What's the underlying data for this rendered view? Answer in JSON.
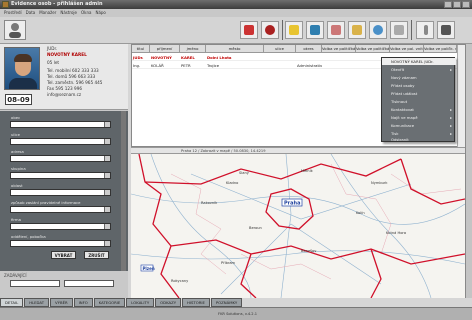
{
  "window": {
    "title": "Evidence osob - přihlášen admin"
  },
  "menu": [
    "Prostředí",
    "Data",
    "Manažer",
    "Nástroje",
    "Okna",
    "Nápo"
  ],
  "toolbar": {
    "tools": [
      "filter",
      "print",
      "note",
      "archive",
      "calendar",
      "edit",
      "search",
      "export",
      "resize",
      "help"
    ]
  },
  "profile": {
    "title_line": "JUDr.",
    "name": "NOVOTNÝ KAREL",
    "born": "05 let",
    "phone1": "Tel. mobilní 602 333 333",
    "phone2": "Tel. domů 596 663 333",
    "phone3": "Tel. zaměstn. 596 965 445",
    "fax": "Fax 595 123 996",
    "email": "info@seznam.cz",
    "badge": "08-09"
  },
  "form": {
    "fields": [
      {
        "label": "obec"
      },
      {
        "label": "ulice"
      },
      {
        "label": "adresa"
      },
      {
        "label": "skupina"
      },
      {
        "label": "oblast"
      },
      {
        "label": "způsob zaslání pravidelné informace"
      },
      {
        "label": "firma"
      },
      {
        "label": "oddělení, pobočka"
      }
    ],
    "btn_vybrat": "VYBRAT",
    "btn_zrusit": "ZRUŠIT",
    "zadavatel_label": "ZADÁVAJÍCÍ"
  },
  "grid": {
    "columns": [
      "titul",
      "příjmení",
      "jméno",
      "město",
      "ulice",
      "okres",
      "Volba ve političkách",
      "Volba ve političkách vnitřní zvolené",
      "Volba ve pol. vnitř. zaměř. odbor",
      "Volba ve políčk. v okolí"
    ],
    "rows": [
      {
        "titul": "JUDr.",
        "prijmeni": "NOVOTNÝ",
        "jmeno": "KAREL",
        "mesto": "Dolní Lhota",
        "ulice": "",
        "okres": "",
        "selected": true
      },
      {
        "titul": "Ing.",
        "prijmeni": "KOLÁŘ",
        "jmeno": "PETR",
        "mesto": "Trojice",
        "ulice": "",
        "okres": "Administrativa",
        "selected": false
      }
    ]
  },
  "context_menu": {
    "header": "NOVOTNÝ KAREL JUDr.",
    "items": [
      {
        "label": "Otevřít",
        "sub": true
      },
      {
        "label": "Nový záznam",
        "sub": false
      },
      {
        "label": "Přidat osoby",
        "sub": false
      },
      {
        "label": "Přidat událost",
        "sub": false
      },
      {
        "label": "Tisknout",
        "sub": false
      },
      {
        "label": "Kontaktovat",
        "sub": true
      },
      {
        "label": "Najít ve mapě",
        "sub": true
      },
      {
        "label": "Komunikace",
        "sub": true
      },
      {
        "label": "Tisk",
        "sub": true
      },
      {
        "label": "Odstranit",
        "sub": false
      }
    ]
  },
  "mapbar": {
    "text": "Praha 12 / Zobrazit v mapě / 50.0830, 14.4219"
  },
  "map": {
    "city_center": "Praha",
    "city_sw": "Plzeň",
    "labels": [
      "Kladno",
      "Slaný",
      "Beroun",
      "Benešov",
      "Kolín",
      "Mělník",
      "Nymburk",
      "Rakovník",
      "Příbram",
      "Kutná Hora",
      "Rokycany"
    ],
    "colors": {
      "border": "#d0102a",
      "road": "#7fa7c8",
      "land": "#f5f4f0"
    }
  },
  "bottom_tabs": [
    "DETAIL",
    "HLEDAT",
    "VÝBĚR",
    "INFO",
    "KATEGORIE",
    "LOKALITY",
    "ODKAZY",
    "HISTORIE",
    "POZNÁMKY"
  ],
  "statusbar": {
    "text": "FKR Solutions, v.4.2.1"
  }
}
